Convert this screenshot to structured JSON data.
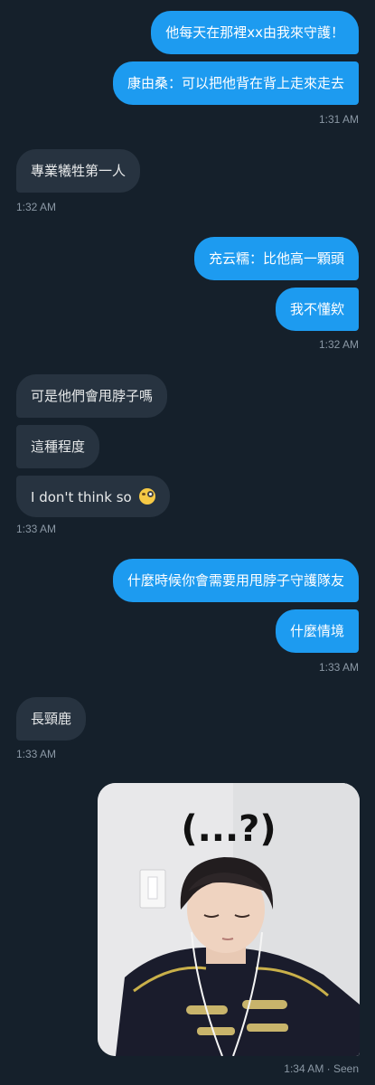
{
  "messages": [
    {
      "text": "他每天在那裡xx由我來守護！"
    },
    {
      "text": "康由桑：可以把他背在背上走來走去"
    },
    {
      "text": "專業犧牲第一人"
    },
    {
      "text": "充云糯：比他高一顆頭"
    },
    {
      "text": "我不懂欸"
    },
    {
      "text": "可是他們會甩脖子嗎"
    },
    {
      "text": "這種程度"
    },
    {
      "text": "I don't think so"
    },
    {
      "text": "什麼時候你會需要用甩脖子守護隊友"
    },
    {
      "text": "什麼情境"
    },
    {
      "text": "長頸鹿"
    }
  ],
  "timestamps": {
    "t1": "1:31 AM",
    "t2": "1:32 AM",
    "t3": "1:32 AM",
    "t4": "1:33 AM",
    "t5": "1:33 AM",
    "t6": "1:33 AM",
    "t7": "1:34 AM · Seen"
  },
  "photo": {
    "caption": "(...?)"
  },
  "icons": {
    "emoji": "face-with-monocle-emoji"
  },
  "colors": {
    "background": "#15202b",
    "outgoing_bubble": "#1d9bf0",
    "incoming_bubble": "#273340",
    "timestamp": "#8b98a5"
  }
}
